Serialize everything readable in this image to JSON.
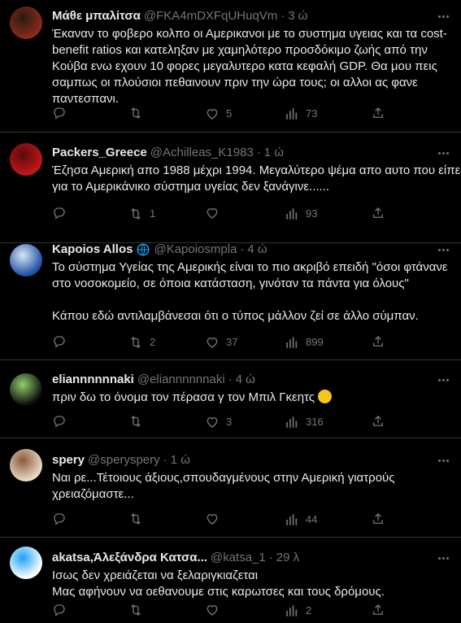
{
  "tweets": [
    {
      "name": "Μάθε μπαλίτσα",
      "handle": "@FKA4mDXFqUHuqVm",
      "time": "3 ώ",
      "verified": false,
      "text": [
        "Έκαναν το φοβερο κολπο οι Αμερικανοι με το συστημα υγειας και τα cost-",
        "benefit ratios και κατεληξαν με χαμηλότερο προσδόκιμο ζωής από την",
        "Κούβα ενω εχουν 10 φορες μεγαλυτερο κατα κεφαλή GDP. Θα μου πεις",
        "σαμπως οι πλούσιοι πεθαινουν πριν την ώρα τους; οι αλλοι ας φανε",
        "παντεσπανι."
      ],
      "stats": {
        "replies": "",
        "retweets": "",
        "likes": "5",
        "views": "73"
      },
      "avatar_colors": [
        "#8a2a1c",
        "#2b1b12"
      ]
    },
    {
      "name": "Packers_Greece",
      "handle": "@Achilleas_K1983",
      "time": "1 ώ",
      "verified": false,
      "text": [
        "Έζησα Αμερική απο 1988 μέχρι 1994. Μεγαλύτερο ψέμα απο αυτο που είπε",
        "για το Αμερικάνικο σύστημα υγείας δεν ξανάγινε......"
      ],
      "stats": {
        "replies": "",
        "retweets": "1",
        "likes": "",
        "views": "93"
      },
      "avatar_colors": [
        "#c0161a",
        "#5a0a0a"
      ]
    },
    {
      "name": "Kapoios Allos",
      "handle": "@Kapoiosmpla",
      "time": "4 ώ",
      "verified": true,
      "text": [
        "Το σύστημα Υγείας της Αμερικής είναι το πιο ακριβό επειδή \"όσοι φτάνανε",
        "στο νοσοκομείο, σε όποια κατάσταση, γινόταν τα πάντα για όλους\"",
        "",
        "Κάπου εδώ αντιλαμβάνεσαι ότι ο τύπος μάλλον ζεί σε άλλο σύμπαν."
      ],
      "stats": {
        "replies": "",
        "retweets": "2",
        "likes": "37",
        "views": "899"
      },
      "avatar_colors": [
        "#1e4fa3",
        "#d8e6f5"
      ]
    },
    {
      "name": "eliannnnnnaki",
      "handle": "@eliannnnnnaki",
      "time": "4 ώ",
      "verified": false,
      "text": [
        "πριν δω το όνομα τον πέρασα γ τον Μπιλ Γκεητς "
      ],
      "emoji": true,
      "stats": {
        "replies": "",
        "retweets": "",
        "likes": "3",
        "views": "316"
      },
      "avatar_colors": [
        "#0d0d0d",
        "#8fd16a"
      ]
    },
    {
      "name": "spery",
      "handle": "@speryspery",
      "time": "1 ώ",
      "verified": false,
      "text": [
        "Ναι ρε...Τέτοιους άξιους,σπουδαγμένους στην Αμερική γιατρούς",
        "χρειαζόμαστε..."
      ],
      "stats": {
        "replies": "",
        "retweets": "",
        "likes": "",
        "views": "44"
      },
      "avatar_colors": [
        "#e8d9c3",
        "#8b5a3c"
      ]
    },
    {
      "name": "akatsa,Άλεξάνδρα Κατσα...",
      "handle": "@katsa_1",
      "time": "29 λ",
      "verified": false,
      "text": [
        "Ισως δεν χρειάζεται να ξελαριγκιαζεται",
        "Μας αφήνουν να οεθανουμε στις καρωτσες και τους δρόμους."
      ],
      "stats": {
        "replies": "",
        "retweets": "",
        "likes": "",
        "views": "2"
      },
      "avatar_colors": [
        "#ffffff",
        "#1da1f2"
      ]
    }
  ]
}
